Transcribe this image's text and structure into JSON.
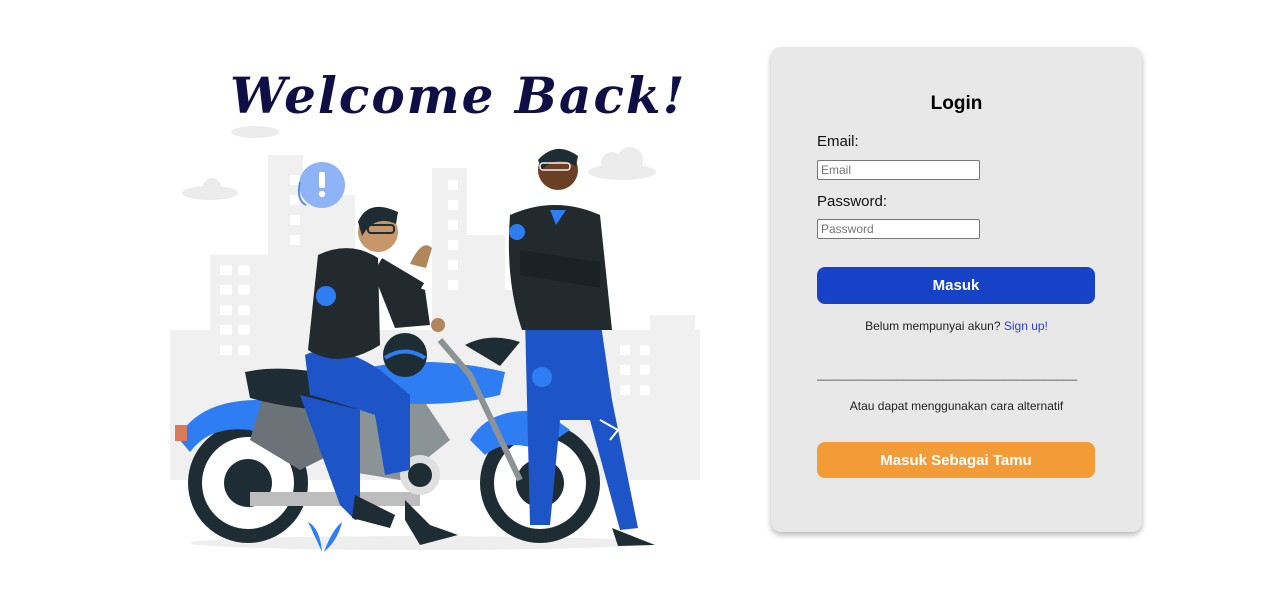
{
  "hero": {
    "heading": "Welcome Back!"
  },
  "login_card": {
    "title": "Login",
    "email_label": "Email:",
    "email_placeholder": "Email",
    "password_label": "Password:",
    "password_placeholder": "Password",
    "submit_label": "Masuk",
    "signup_prompt": "Belum mempunyai akun?",
    "signup_link": "Sign up!",
    "divider": "_______________________________________",
    "alternative_text": "Atau dapat menggunakan cara alternatif",
    "guest_label": "Masuk Sebagai Tamu"
  },
  "colors": {
    "primary_button": "#1642c7",
    "guest_button": "#f39b37",
    "card_background": "#e8e8e8",
    "heading": "#0f0f45",
    "link": "#2d3fd6"
  }
}
